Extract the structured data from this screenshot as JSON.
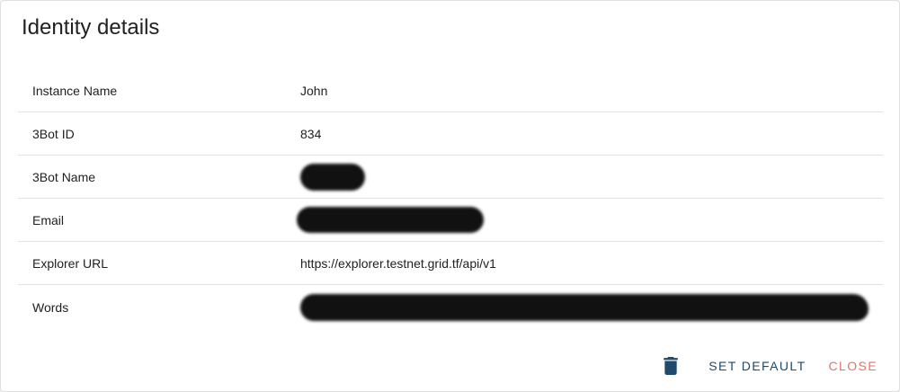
{
  "dialog": {
    "title": "Identity details"
  },
  "details": {
    "rows": [
      {
        "label": "Instance Name",
        "value": "John"
      },
      {
        "label": "3Bot ID",
        "value": "834"
      },
      {
        "label": "3Bot Name",
        "value": ""
      },
      {
        "label": "Email",
        "value": ""
      },
      {
        "label": "Explorer URL",
        "value": "https://explorer.testnet.grid.tf/api/v1"
      },
      {
        "label": "Words",
        "value": ""
      }
    ]
  },
  "actions": {
    "delete_icon": "trash-icon",
    "set_default_label": "Set Default",
    "close_label": "Close"
  },
  "colors": {
    "primary": "#1e4a6b",
    "close": "#e57366",
    "divider": "#e0e0e0"
  }
}
